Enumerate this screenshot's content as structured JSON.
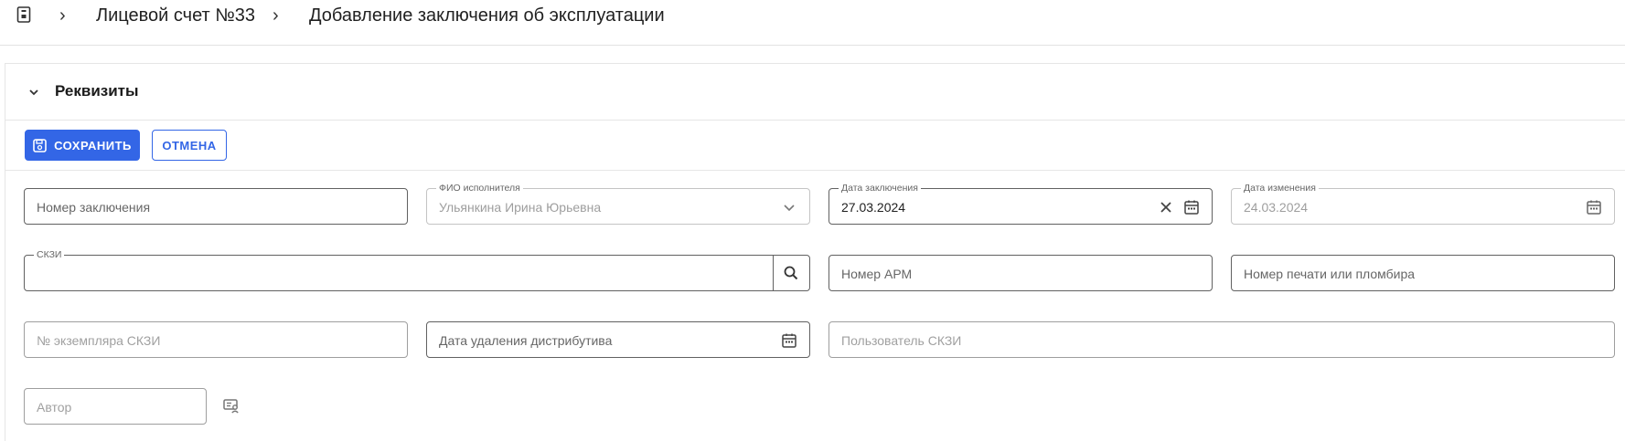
{
  "breadcrumb": {
    "items": [
      "Лицевой счет №33",
      "Добавление заключения об эксплуатации"
    ]
  },
  "section": {
    "title": "Реквизиты"
  },
  "toolbar": {
    "save_label": "СОХРАНИТЬ",
    "cancel_label": "ОТМЕНА"
  },
  "form": {
    "conclusion_number": {
      "placeholder": "Номер заключения"
    },
    "executor": {
      "label": "ФИО исполнителя",
      "value": "Ульянкина Ирина Юрьевна"
    },
    "conclusion_date": {
      "label": "Дата заключения",
      "value": "27.03.2024"
    },
    "change_date": {
      "label": "Дата изменения",
      "value": "24.03.2024"
    },
    "skzi": {
      "label": "СКЗИ",
      "value": ""
    },
    "arm_number": {
      "placeholder": "Номер АРМ"
    },
    "seal_number": {
      "placeholder": "Номер печати или пломбира"
    },
    "skzi_copy_number": {
      "placeholder": "№ экземпляра СКЗИ"
    },
    "distributive_delete_date": {
      "placeholder": "Дата удаления дистрибутива"
    },
    "skzi_user": {
      "placeholder": "Пользователь СКЗИ"
    },
    "author": {
      "placeholder": "Автор"
    }
  },
  "colors": {
    "accent": "#3366e6",
    "border": "#9e9e9e",
    "divider": "#e6e6e6"
  }
}
